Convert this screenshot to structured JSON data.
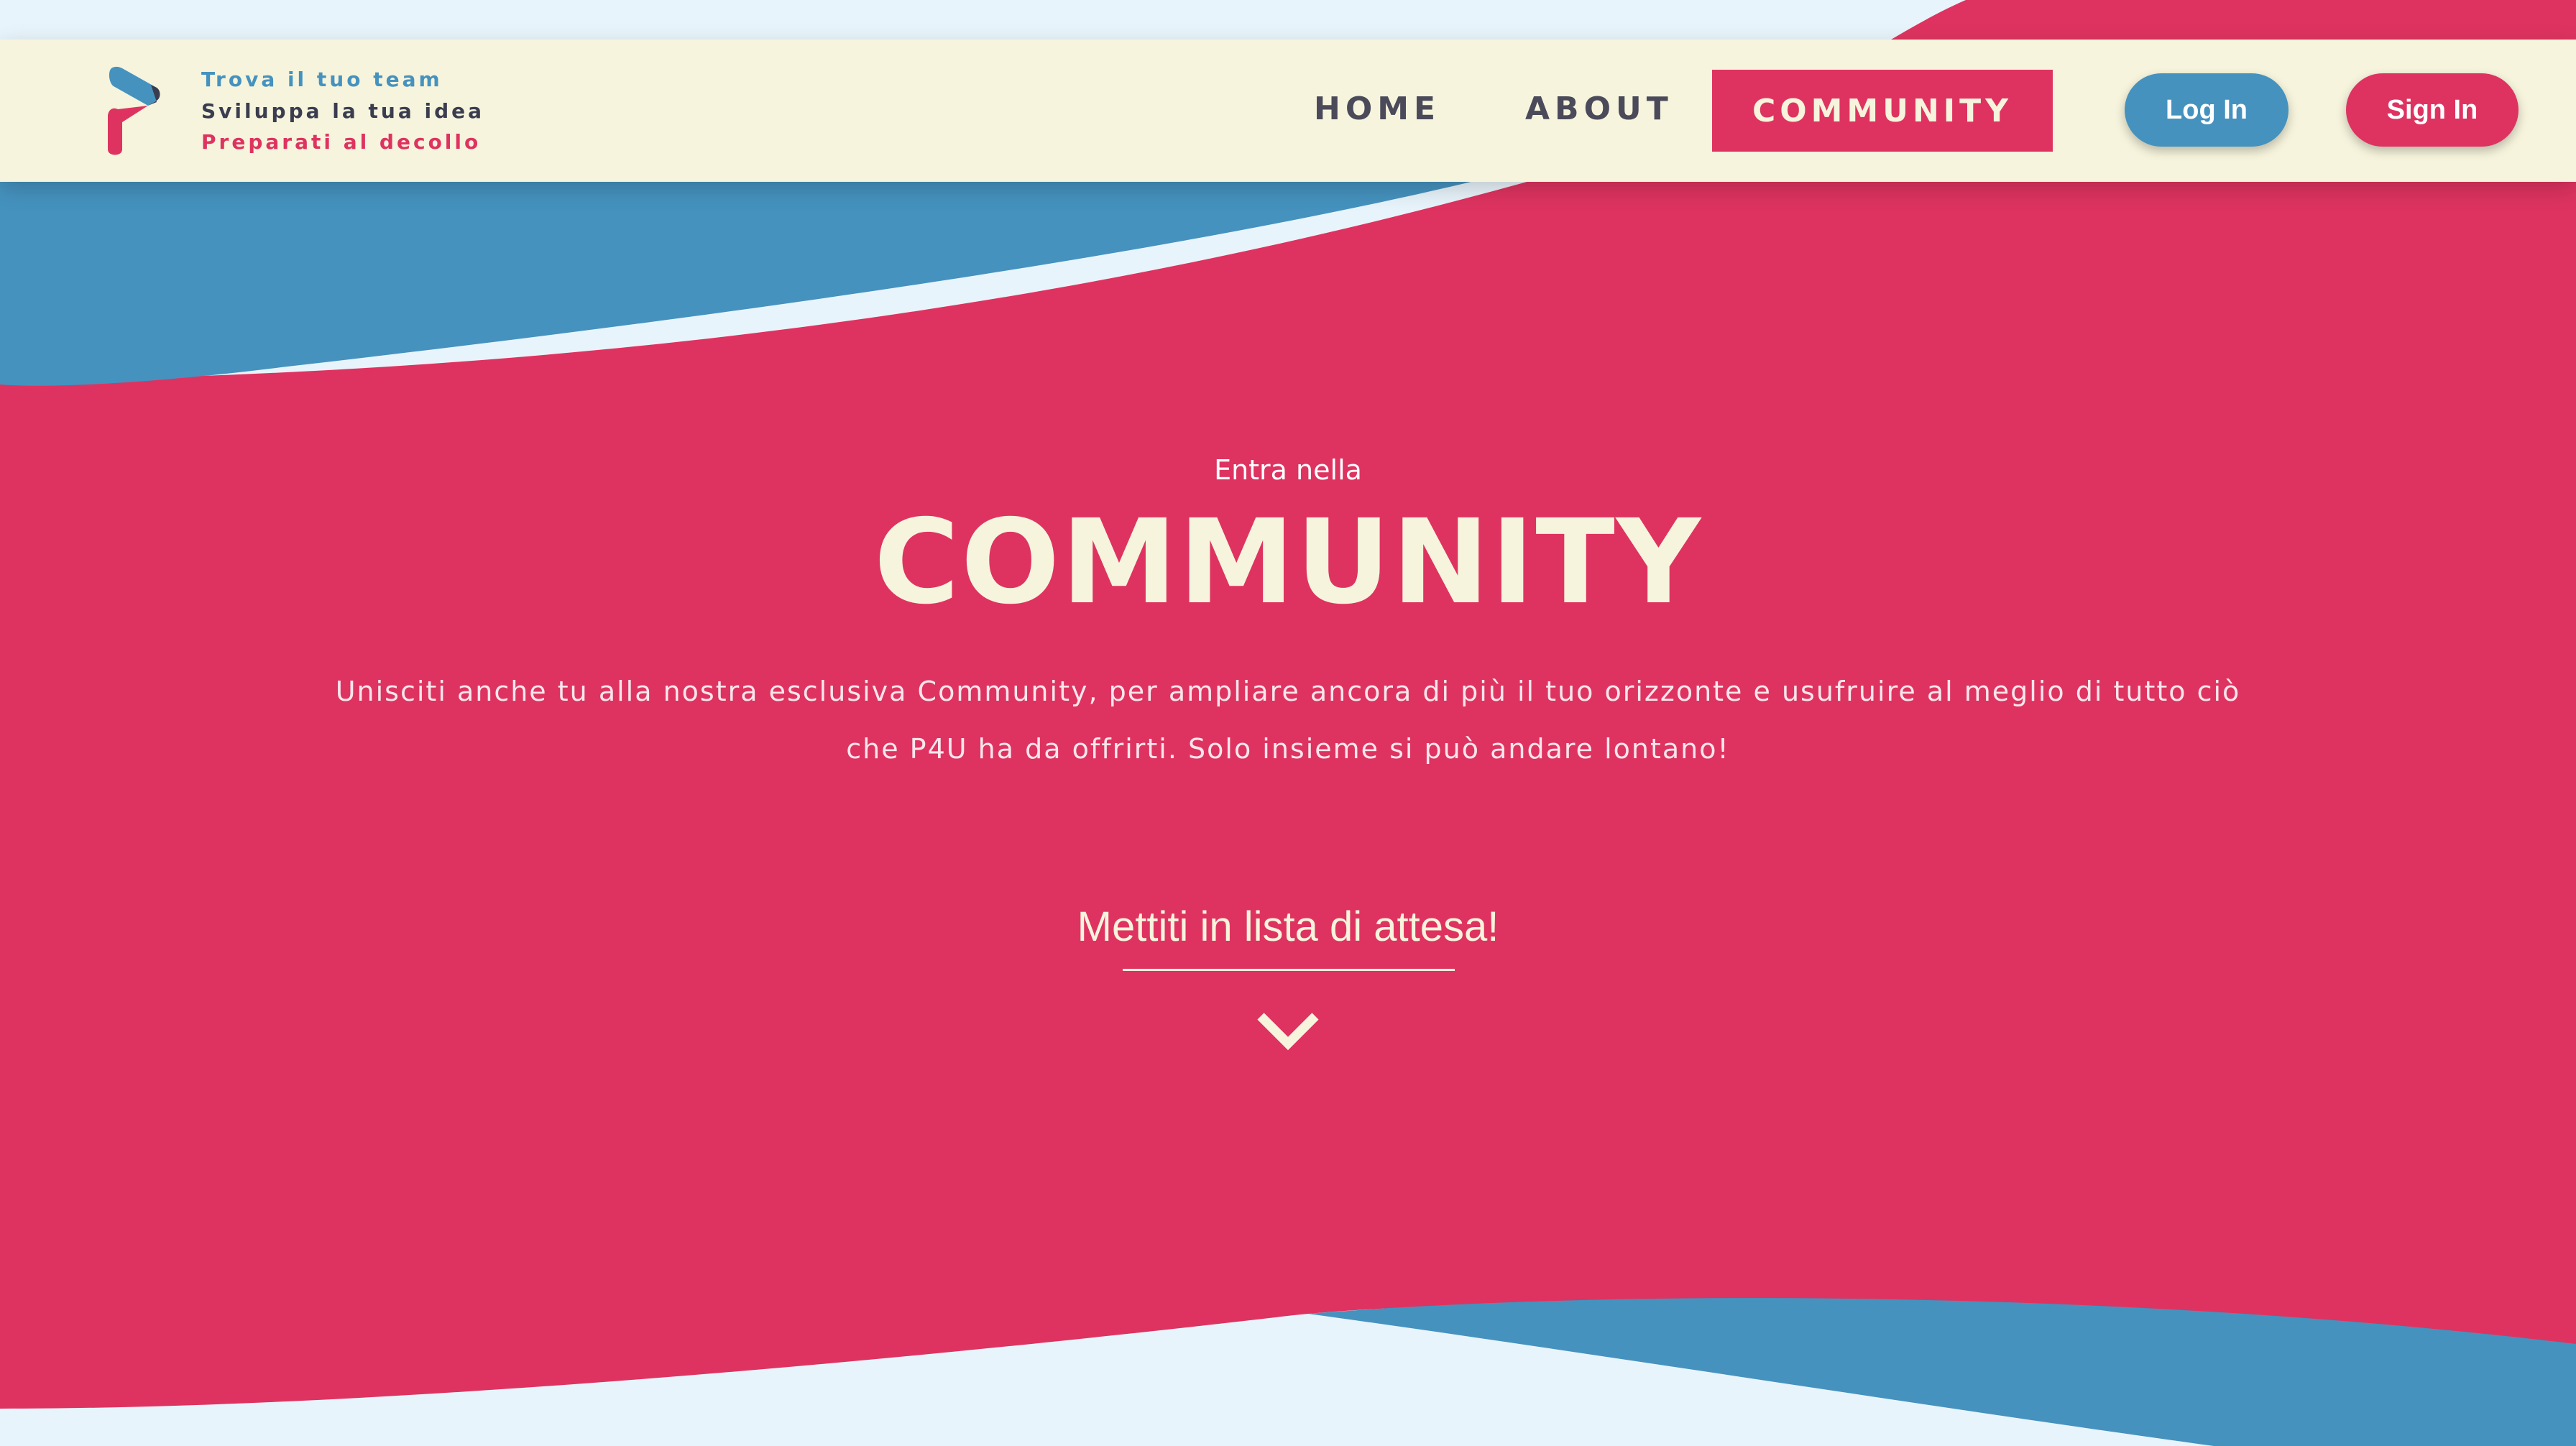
{
  "header": {
    "taglines": [
      "Trova il tuo team",
      "Sviluppa la tua idea",
      "Preparati al decollo"
    ],
    "nav": {
      "home": "HOME",
      "about": "ABOUT",
      "community": "COMMUNITY"
    },
    "login_label": "Log In",
    "signin_label": "Sign In"
  },
  "hero": {
    "pretitle": "Entra nella",
    "title": "COMMUNITY",
    "description": "Unisciti anche tu alla nostra esclusiva Community, per ampliare ancora di più il tuo orizzonte e usufruire al meglio di tutto ciò che P4U ha da offrirti. Solo insieme si può andare lontano!",
    "waitlist_label": "Mettiti in lista di attesa!"
  },
  "icons": {
    "logo": "p4u-logo-icon",
    "scroll": "chevron-down-icon"
  },
  "colors": {
    "primary_red": "#de3360",
    "primary_blue": "#4592bf",
    "cream": "#f6f4dc",
    "dark_text": "#3a3d4f",
    "light_bg": "#e8f4fb"
  }
}
